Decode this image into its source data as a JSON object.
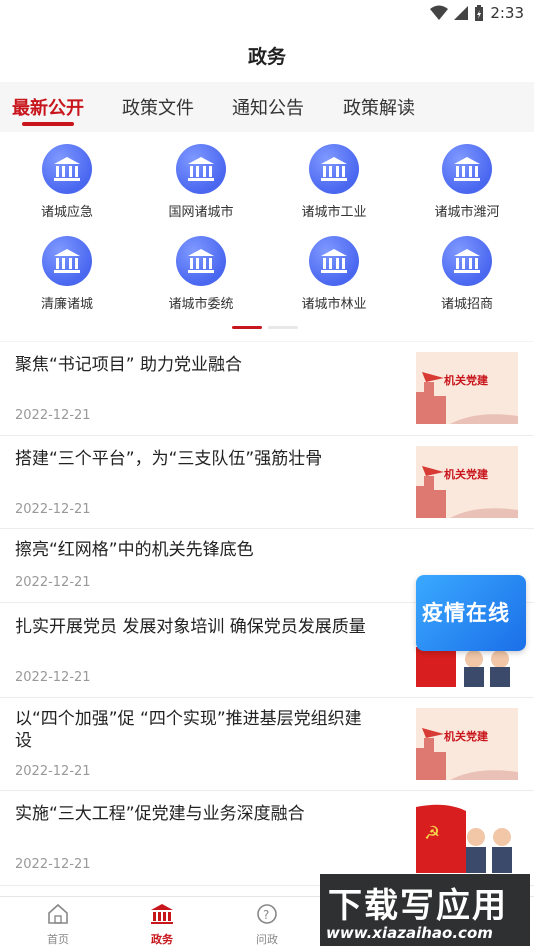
{
  "status": {
    "time": "2:33"
  },
  "header": {
    "title": "政务"
  },
  "tabs": [
    {
      "label": "最新公开"
    },
    {
      "label": "政策文件"
    },
    {
      "label": "通知公告"
    },
    {
      "label": "政策解读"
    }
  ],
  "grid": [
    {
      "label": "诸城应急"
    },
    {
      "label": "国网诸城市"
    },
    {
      "label": "诸城市工业"
    },
    {
      "label": "诸城市潍河"
    },
    {
      "label": "清廉诸城"
    },
    {
      "label": "诸城市委统"
    },
    {
      "label": "诸城市林业"
    },
    {
      "label": "诸城招商"
    }
  ],
  "news": [
    {
      "title": "聚焦“书记项目” 助力党业融合",
      "date": "2022-12-21",
      "thumb_text": "机关党建"
    },
    {
      "title": "搭建“三个平台”，为“三支队伍”强筋壮骨",
      "date": "2022-12-21",
      "thumb_text": "机关党建"
    },
    {
      "title": "擦亮“红网格”中的机关先锋底色",
      "date": "2022-12-21"
    },
    {
      "title": "扎实开展党员 发展对象培训 确保党员发展质量",
      "date": "2022-12-21"
    },
    {
      "title_line1": "以“四个加强”促 “四个实现”推进基层党组织建",
      "title_line2": "设",
      "date": "2022-12-21",
      "thumb_text": "机关党建"
    },
    {
      "title": "实施“三大工程”促党建与业务深度融合",
      "date": "2022-12-21"
    }
  ],
  "floating_banner": {
    "text": "疫情在线"
  },
  "tabbar": [
    {
      "label": "首页",
      "icon": "home-icon"
    },
    {
      "label": "政务",
      "icon": "government-icon"
    },
    {
      "label": "问政",
      "icon": "question-icon"
    }
  ],
  "watermark": {
    "big": "下载写应用",
    "small": "www.xiazaihao.com"
  },
  "colors": {
    "accent": "#c8161d",
    "icon_blue": "#4a67f0"
  }
}
